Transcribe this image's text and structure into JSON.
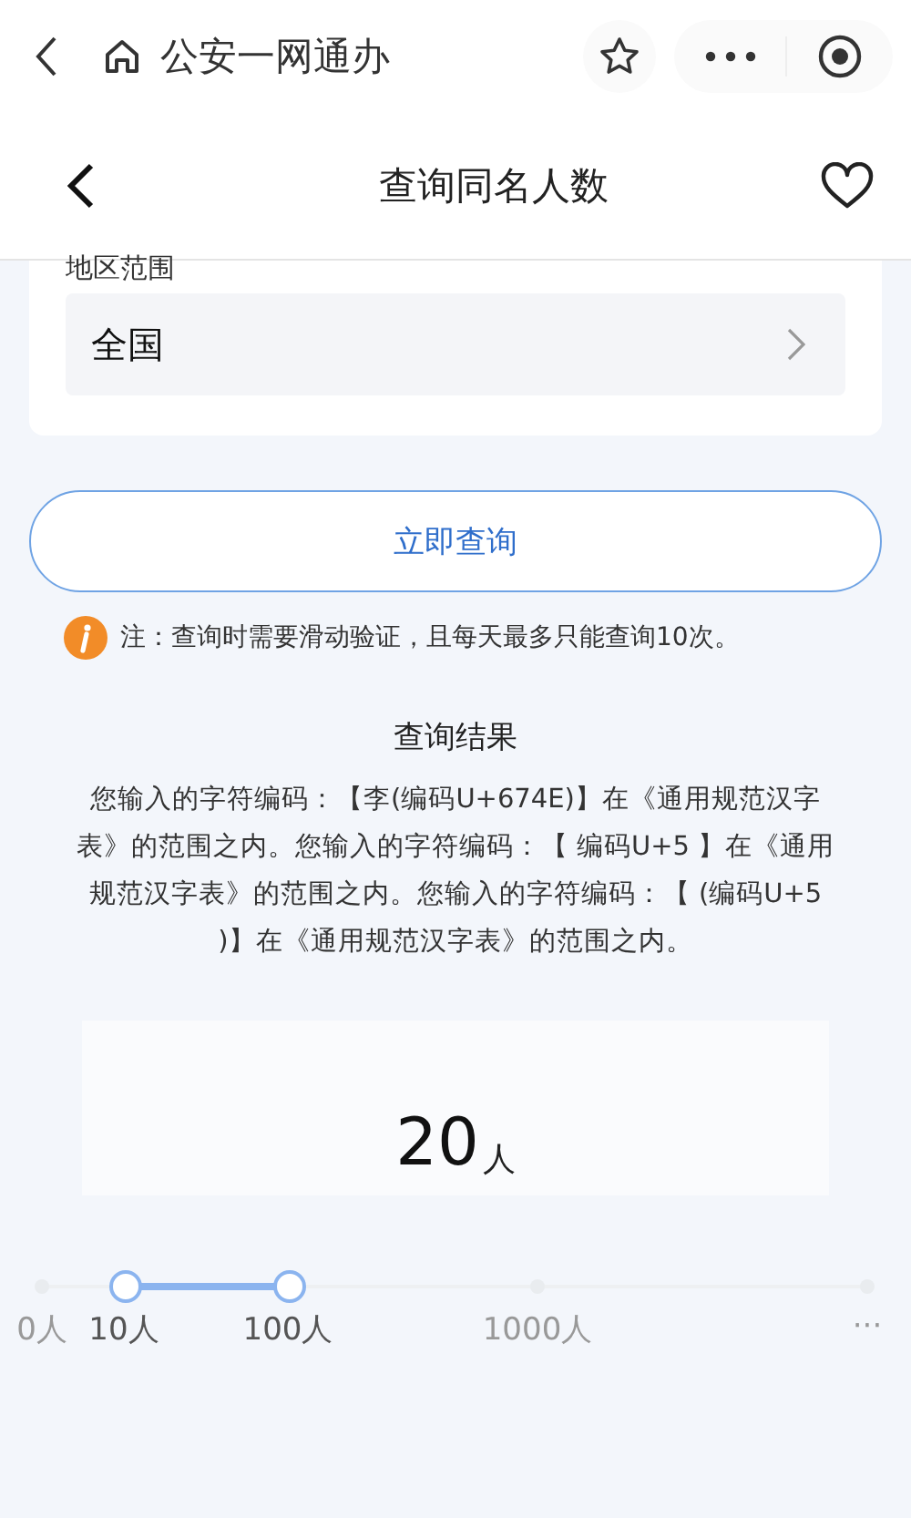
{
  "top_bar": {
    "title": "公安一网通办"
  },
  "header": {
    "title": "查询同名人数"
  },
  "form": {
    "label": "地区范围",
    "value": "全国"
  },
  "submit": {
    "label": "立即查询"
  },
  "note": "注：查询时需要滑动验证，且每天最多只能查询10次。",
  "result": {
    "title": "查询结果",
    "text": "您输入的字符编码：【李(编码U+674E)】在《通用规范汉字表》的范围之内。您输入的字符编码：【 编码U+5 】在《通用规范汉字表》的范围之内。您输入的字符编码：【 (编码U+5 )】在《通用规范汉字表》的范围之内。",
    "count": "20",
    "unit": "人"
  },
  "scale": [
    {
      "label": "0人",
      "selected": false
    },
    {
      "label": "10人",
      "selected": true
    },
    {
      "label": "100人",
      "selected": true
    },
    {
      "label": "1000人",
      "selected": false
    },
    {
      "label": "···",
      "selected": false
    }
  ]
}
